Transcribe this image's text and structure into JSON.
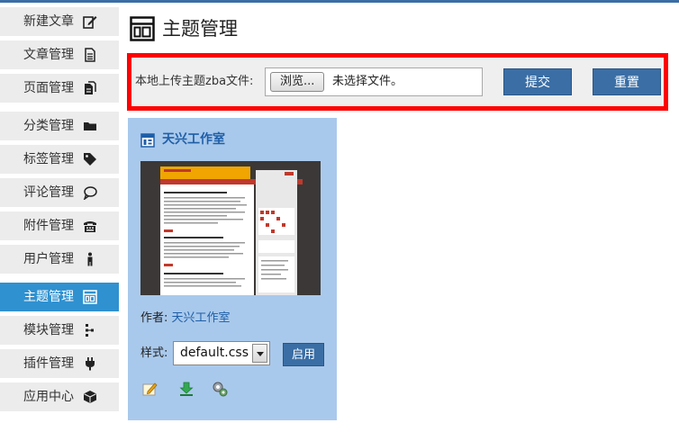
{
  "sidebar": {
    "items": [
      {
        "label": "新建文章",
        "icon": "edit-icon"
      },
      {
        "label": "文章管理",
        "icon": "document-icon"
      },
      {
        "label": "页面管理",
        "icon": "pages-icon"
      },
      {
        "label": "分类管理",
        "icon": "folder-icon"
      },
      {
        "label": "标签管理",
        "icon": "tag-icon"
      },
      {
        "label": "评论管理",
        "icon": "comment-icon"
      },
      {
        "label": "附件管理",
        "icon": "attachment-icon"
      },
      {
        "label": "用户管理",
        "icon": "user-icon"
      },
      {
        "label": "主题管理",
        "icon": "theme-icon",
        "active": true
      },
      {
        "label": "模块管理",
        "icon": "module-icon"
      },
      {
        "label": "插件管理",
        "icon": "plugin-icon"
      },
      {
        "label": "应用中心",
        "icon": "app-center-icon"
      }
    ]
  },
  "header": {
    "title": "主题管理",
    "icon": "theme-icon"
  },
  "upload": {
    "label": "本地上传主题zba文件:",
    "browse_label": "浏览...",
    "no_file_text": "未选择文件。",
    "submit_label": "提交",
    "reset_label": "重置"
  },
  "theme": {
    "name": "天兴工作室",
    "author_label": "作者:",
    "author_name": "天兴工作室",
    "style_label": "样式:",
    "style_value": "default.css",
    "enable_label": "启用",
    "actions": [
      "edit-icon",
      "download-icon",
      "settings-icon"
    ]
  },
  "colors": {
    "accent": "#3a6ea5",
    "active_nav": "#2f91d0",
    "highlight_border": "#ff0000",
    "theme_card_bg": "#a9c9ec"
  }
}
